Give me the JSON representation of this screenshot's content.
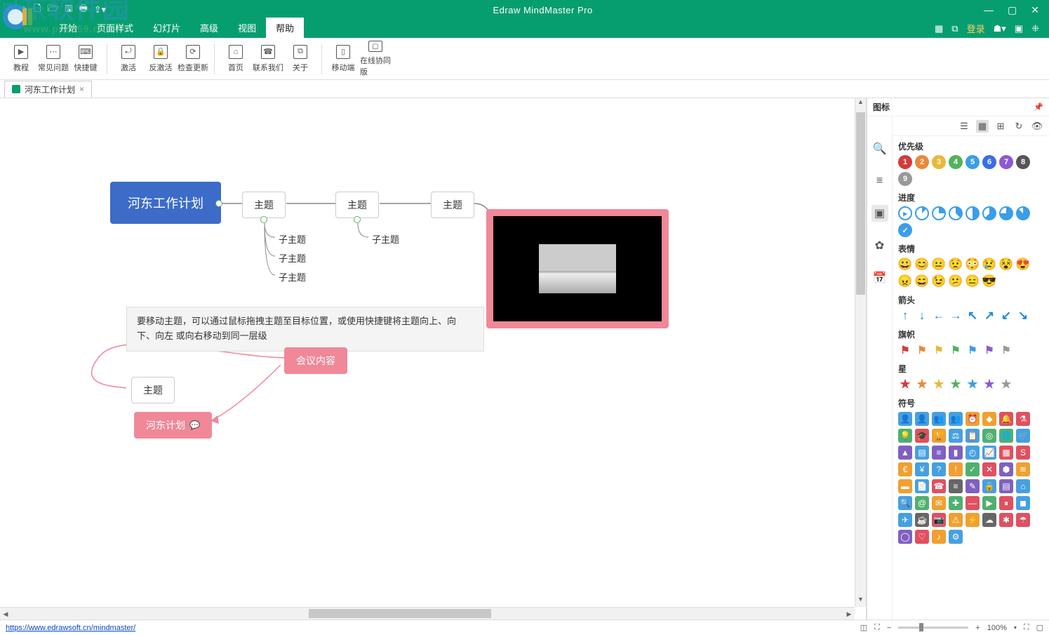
{
  "app": {
    "title": "Edraw MindMaster Pro"
  },
  "qat": [
    "↶",
    "↷",
    "🗋",
    "🗁",
    "🖫",
    "🖶",
    "⇪▾"
  ],
  "winctl": [
    "—",
    "▢",
    "✕"
  ],
  "menutabs": [
    "开始",
    "页面样式",
    "幻灯片",
    "高级",
    "视图",
    "帮助"
  ],
  "menutabs_active": 5,
  "menuright": {
    "icons": [
      "▦",
      "⧉"
    ],
    "login": "登录",
    "extra": [
      "☗▾",
      "▣",
      "⁜"
    ]
  },
  "ribbon": [
    {
      "label": "教程",
      "icon": "▶"
    },
    {
      "label": "常见问题",
      "icon": "⋯"
    },
    {
      "label": "快捷键",
      "icon": "⌨"
    },
    {
      "sep": true
    },
    {
      "label": "激活",
      "icon": "⤾"
    },
    {
      "label": "反激活",
      "icon": "🔒"
    },
    {
      "label": "检查更新",
      "icon": "⟳"
    },
    {
      "sep": true
    },
    {
      "label": "首页",
      "icon": "⌂"
    },
    {
      "label": "联系我们",
      "icon": "☎"
    },
    {
      "label": "关于",
      "icon": "⧉"
    },
    {
      "sep": true
    },
    {
      "label": "移动端",
      "icon": "▯"
    },
    {
      "label": "在线协同版",
      "icon": "◻"
    }
  ],
  "doctab": {
    "name": "河东工作计划"
  },
  "mindmap": {
    "root": "河东工作计划",
    "topics": [
      "主题",
      "主题",
      "主题"
    ],
    "subtopics": [
      "子主题",
      "子主题",
      "子主题"
    ],
    "sub2": "子主题",
    "float_topic": "主题",
    "pink1": "会议内容",
    "pink2": "河东计划",
    "info": "要移动主题，可以通过鼠标拖拽主题至目标位置，或使用快捷键将主题向上、向下、向左 或向右移动到同一层级"
  },
  "sidepanel": {
    "title": "图标",
    "rail": [
      "🔍",
      "≡",
      "▣",
      "✿",
      "📅"
    ],
    "rail_active": 2,
    "toolbar": [
      "☰",
      "▦",
      "⊞",
      "↻",
      "👁"
    ],
    "toolbar_active": 1,
    "groups": [
      {
        "title": "优先级",
        "type": "priority",
        "items": [
          {
            "t": "1",
            "c": "#d43a3a"
          },
          {
            "t": "2",
            "c": "#e8893a"
          },
          {
            "t": "3",
            "c": "#e8b83a"
          },
          {
            "t": "4",
            "c": "#52b35a"
          },
          {
            "t": "5",
            "c": "#3a9ee8"
          },
          {
            "t": "6",
            "c": "#3a6ee8"
          },
          {
            "t": "7",
            "c": "#8a5ad0"
          },
          {
            "t": "8",
            "c": "#555"
          },
          {
            "t": "9",
            "c": "#999"
          }
        ]
      },
      {
        "title": "进度",
        "type": "progress",
        "items": [
          {
            "c": "#3a9ee8",
            "p": 0
          },
          {
            "c": "#3a9ee8",
            "p": 12
          },
          {
            "c": "#3a9ee8",
            "p": 25
          },
          {
            "c": "#3a9ee8",
            "p": 37
          },
          {
            "c": "#3a9ee8",
            "p": 50
          },
          {
            "c": "#3a9ee8",
            "p": 62
          },
          {
            "c": "#3a9ee8",
            "p": 75
          },
          {
            "c": "#3a9ee8",
            "p": 87
          },
          {
            "c": "#3a9ee8",
            "p": 100
          }
        ]
      },
      {
        "title": "表情",
        "type": "emoji",
        "items": [
          "😀",
          "😊",
          "😐",
          "😟",
          "😳",
          "😢",
          "😵",
          "😍",
          "😠",
          "😄",
          "😉",
          "😕",
          "😑",
          "😎"
        ]
      },
      {
        "title": "箭头",
        "type": "arrow",
        "items": [
          "↑",
          "↓",
          "←",
          "→",
          "↖",
          "↗",
          "↙",
          "↘"
        ],
        "c": "#1a88d8"
      },
      {
        "title": "旗帜",
        "type": "flag",
        "items": [
          "#d43a3a",
          "#e8893a",
          "#e8b83a",
          "#52b35a",
          "#3a9ee8",
          "#8a5ad0",
          "#999"
        ]
      },
      {
        "title": "星",
        "type": "star",
        "items": [
          "#d43a3a",
          "#e8893a",
          "#e8b83a",
          "#52b35a",
          "#3a9ee8",
          "#8a5ad0",
          "#999"
        ]
      },
      {
        "title": "符号",
        "type": "symbol",
        "items": [
          {
            "t": "👤",
            "c": "#46a0e0"
          },
          {
            "t": "👤",
            "c": "#46a0e0"
          },
          {
            "t": "👥",
            "c": "#46a0e0"
          },
          {
            "t": "👥",
            "c": "#46a0e0"
          },
          {
            "t": "⏰",
            "c": "#f0a030"
          },
          {
            "t": "◆",
            "c": "#f0a030"
          },
          {
            "t": "🔔",
            "c": "#e05060"
          },
          {
            "t": "⚗",
            "c": "#e05060"
          },
          {
            "t": "💡",
            "c": "#50b070"
          },
          {
            "t": "🎓",
            "c": "#e05060"
          },
          {
            "t": "🏆",
            "c": "#f0a030"
          },
          {
            "t": "⚖",
            "c": "#46a0e0"
          },
          {
            "t": "📋",
            "c": "#46a0e0"
          },
          {
            "t": "◎",
            "c": "#50b070"
          },
          {
            "t": "🌐",
            "c": "#50b070"
          },
          {
            "t": "🛒",
            "c": "#46a0e0"
          },
          {
            "t": "▲",
            "c": "#8060c0"
          },
          {
            "t": "▤",
            "c": "#46a0e0"
          },
          {
            "t": "≡",
            "c": "#8060c0"
          },
          {
            "t": "▮",
            "c": "#8060c0"
          },
          {
            "t": "◴",
            "c": "#46a0e0"
          },
          {
            "t": "📈",
            "c": "#46a0e0"
          },
          {
            "t": "▦",
            "c": "#e05060"
          },
          {
            "t": "S",
            "c": "#e05060"
          },
          {
            "t": "€",
            "c": "#f0a030"
          },
          {
            "t": "¥",
            "c": "#46a0e0"
          },
          {
            "t": "?",
            "c": "#46a0e0"
          },
          {
            "t": "!",
            "c": "#f0a030"
          },
          {
            "t": "✓",
            "c": "#50b070"
          },
          {
            "t": "✕",
            "c": "#e05060"
          },
          {
            "t": "⬢",
            "c": "#8060c0"
          },
          {
            "t": "≋",
            "c": "#f0a030"
          },
          {
            "t": "▬",
            "c": "#f0a030"
          },
          {
            "t": "📄",
            "c": "#46a0e0"
          },
          {
            "t": "☎",
            "c": "#e05060"
          },
          {
            "t": "≡",
            "c": "#666"
          },
          {
            "t": "✎",
            "c": "#8060c0"
          },
          {
            "t": "🔒",
            "c": "#46a0e0"
          },
          {
            "t": "▤",
            "c": "#8060c0"
          },
          {
            "t": "⌂",
            "c": "#46a0e0"
          },
          {
            "t": "🔍",
            "c": "#46a0e0"
          },
          {
            "t": "@",
            "c": "#50b070"
          },
          {
            "t": "✉",
            "c": "#f0a030"
          },
          {
            "t": "✚",
            "c": "#50b070"
          },
          {
            "t": "—",
            "c": "#e05060"
          },
          {
            "t": "▶",
            "c": "#50b070"
          },
          {
            "t": "⏸",
            "c": "#e05060"
          },
          {
            "t": "◼",
            "c": "#46a0e0"
          },
          {
            "t": "✈",
            "c": "#46a0e0"
          },
          {
            "t": "☕",
            "c": "#666"
          },
          {
            "t": "📷",
            "c": "#e05060"
          },
          {
            "t": "⚠",
            "c": "#f0a030"
          },
          {
            "t": "⚡",
            "c": "#f0a030"
          },
          {
            "t": "☁",
            "c": "#666"
          },
          {
            "t": "✱",
            "c": "#e05060"
          },
          {
            "t": "☂",
            "c": "#e05060"
          },
          {
            "t": "◯",
            "c": "#8060c0"
          },
          {
            "t": "♡",
            "c": "#e05060"
          },
          {
            "t": "♪",
            "c": "#f0a030"
          },
          {
            "t": "⚙",
            "c": "#46a0e0"
          }
        ]
      }
    ]
  },
  "statusbar": {
    "url": "https://www.edrawsoft.cn/mindmaster/",
    "zoom": "100%",
    "icons_left": [
      "◫",
      "⛶"
    ],
    "icons_right": [
      "⛶",
      "▢"
    ]
  },
  "watermark": {
    "main": "河东软件园",
    "sub": "www.pc0359.cn"
  }
}
